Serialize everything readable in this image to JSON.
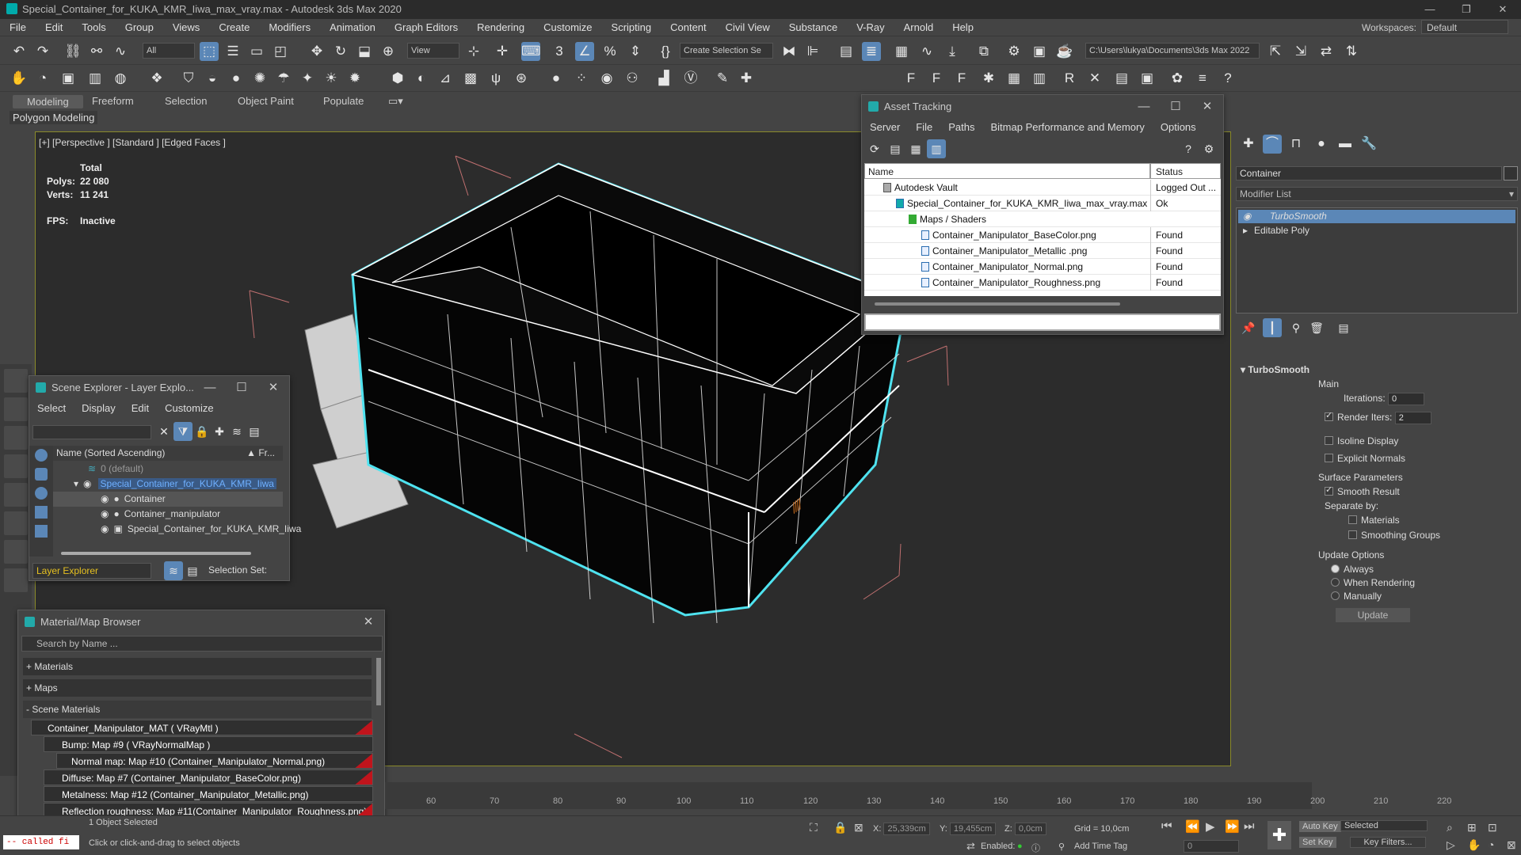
{
  "window": {
    "title": "Special_Container_for_KUKA_KMR_Iiwa_max_vray.max - Autodesk 3ds Max 2020"
  },
  "menu": [
    "File",
    "Edit",
    "Tools",
    "Group",
    "Views",
    "Create",
    "Modifiers",
    "Animation",
    "Graph Editors",
    "Rendering",
    "Customize",
    "Scripting",
    "Content",
    "Civil View",
    "Substance",
    "V-Ray",
    "Arnold",
    "Help"
  ],
  "workspace": {
    "label": "Workspaces:",
    "value": "Default"
  },
  "toolbar": {
    "filter": "All",
    "view": "View",
    "selection_set": "Create Selection Se",
    "path": "C:\\Users\\lukya\\Documents\\3ds Max 2022"
  },
  "ribbon": {
    "tabs": [
      "Modeling",
      "Freeform",
      "Selection",
      "Object Paint",
      "Populate"
    ],
    "sub": "Polygon Modeling"
  },
  "viewport": {
    "label": "[+] [Perspective ] [Standard ] [Edged Faces ]",
    "total": "Total",
    "polys_label": "Polys:",
    "polys": "22 080",
    "verts_label": "Verts:",
    "verts": "11 241",
    "fps_label": "FPS:",
    "fps": "Inactive"
  },
  "asset_tracking": {
    "title": "Asset Tracking",
    "menu": [
      "Server",
      "File",
      "Paths",
      "Bitmap Performance and Memory",
      "Options"
    ],
    "col_name": "Name",
    "col_status": "Status",
    "rows": [
      {
        "name": "Autodesk Vault",
        "status": "Logged Out ..."
      },
      {
        "name": "Special_Container_for_KUKA_KMR_Iiwa_max_vray.max",
        "status": "Ok"
      },
      {
        "name": "Maps / Shaders",
        "status": ""
      },
      {
        "name": "Container_Manipulator_BaseColor.png",
        "status": "Found"
      },
      {
        "name": "Container_Manipulator_Metallic .png",
        "status": "Found"
      },
      {
        "name": "Container_Manipulator_Normal.png",
        "status": "Found"
      },
      {
        "name": "Container_Manipulator_Roughness.png",
        "status": "Found"
      }
    ]
  },
  "scene_explorer": {
    "title": "Scene Explorer - Layer Explo...",
    "menu": [
      "Select",
      "Display",
      "Edit",
      "Customize"
    ],
    "col_name": "Name (Sorted Ascending)",
    "col_fr": "▲ Fr...",
    "rows": [
      "0 (default)",
      "Special_Container_for_KUKA_KMR_Iiwa",
      "Container",
      "Container_manipulator",
      "Special_Container_for_KUKA_KMR_Iiwa"
    ],
    "footer_explorer": "Layer Explorer",
    "footer_selset": "Selection Set:"
  },
  "mat_browser": {
    "title": "Material/Map Browser",
    "search": "Search by Name ...",
    "sections": [
      "+ Materials",
      "+ Maps",
      "- Scene Materials"
    ],
    "items": [
      "Container_Manipulator_MAT ( VRayMtl )",
      "Bump: Map #9 ( VRayNormalMap )",
      "Normal map: Map #10 (Container_Manipulator_Normal.png)",
      "Diffuse: Map #7 (Container_Manipulator_BaseColor.png)",
      "Metalness: Map #12 (Container_Manipulator_Metallic.png)",
      "Reflection roughness: Map #11(Container_Manipulator_Roughness.png)"
    ]
  },
  "command_panel": {
    "object_name": "Container",
    "modifier_list": "Modifier List",
    "stack": [
      "TurboSmooth",
      "Editable Poly"
    ],
    "rollout": "TurboSmooth",
    "main": "Main",
    "iterations_label": "Iterations:",
    "iterations": "0",
    "render_iters_label": "Render Iters:",
    "render_iters": "2",
    "isoline": "Isoline Display",
    "explicit": "Explicit Normals",
    "surface_params": "Surface Parameters",
    "smooth_result": "Smooth Result",
    "separate_by": "Separate by:",
    "materials": "Materials",
    "smoothing_groups": "Smoothing Groups",
    "update_options": "Update Options",
    "always": "Always",
    "when_rendering": "When Rendering",
    "manually": "Manually",
    "update": "Update"
  },
  "timeline": {
    "ticks": [
      "60",
      "70",
      "80",
      "90",
      "100",
      "110",
      "120",
      "130",
      "140",
      "150",
      "160",
      "170",
      "180",
      "190",
      "200",
      "210",
      "220"
    ]
  },
  "status": {
    "selected": "1 Object Selected",
    "hint": "Click or click-and-drag to select objects",
    "script": "-- called fi",
    "x_label": "X:",
    "x": "25,339cm",
    "y_label": "Y:",
    "y": "19,455cm",
    "z_label": "Z:",
    "z": "0,0cm",
    "grid": "Grid = 10,0cm",
    "enabled": "Enabled:",
    "add_time_tag": "Add Time Tag",
    "auto_key": "Auto Key",
    "set_key": "Set Key",
    "selected_dd": "Selected",
    "key_filters": "Key Filters...",
    "frame": "0"
  }
}
